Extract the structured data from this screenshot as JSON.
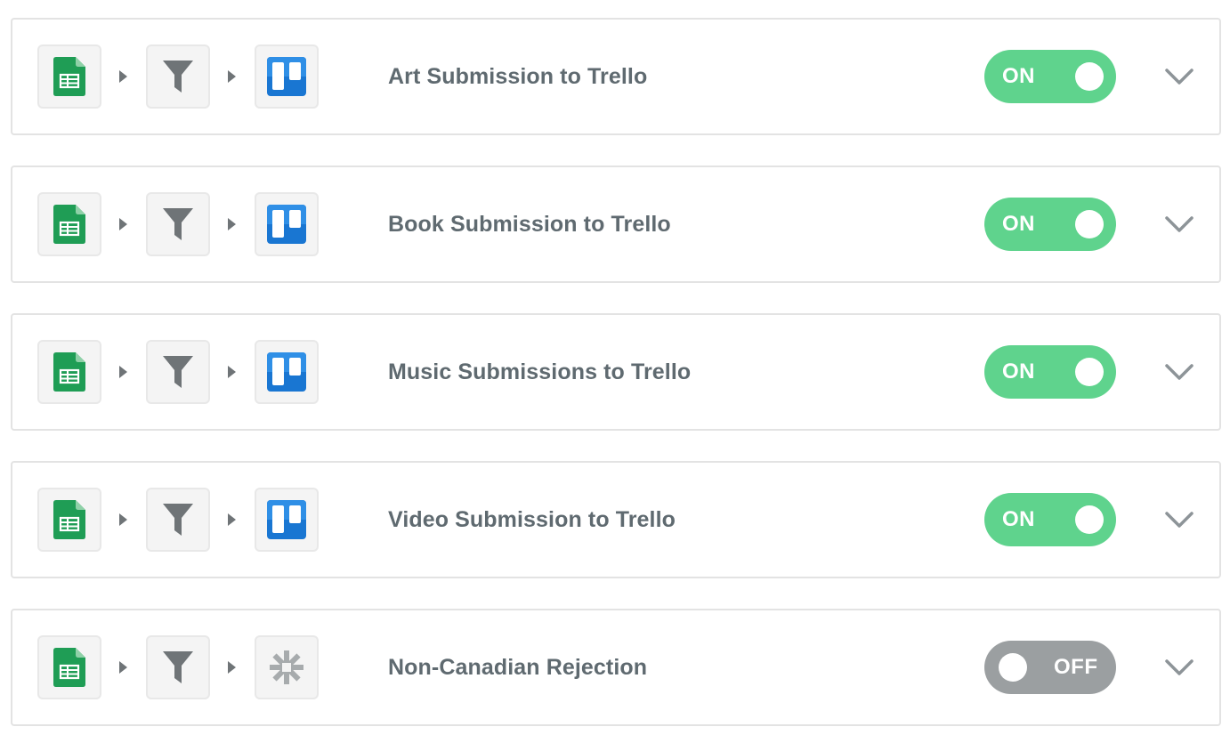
{
  "zaps": [
    {
      "title": "Art Submission to Trello",
      "trigger_icon": "google-sheets-icon",
      "filter_icon": "filter-icon",
      "action_icon": "trello-icon",
      "status": "on",
      "status_label": "ON"
    },
    {
      "title": "Book Submission to Trello",
      "trigger_icon": "google-sheets-icon",
      "filter_icon": "filter-icon",
      "action_icon": "trello-icon",
      "status": "on",
      "status_label": "ON"
    },
    {
      "title": "Music Submissions to Trello",
      "trigger_icon": "google-sheets-icon",
      "filter_icon": "filter-icon",
      "action_icon": "trello-icon",
      "status": "on",
      "status_label": "ON"
    },
    {
      "title": "Video Submission to Trello",
      "trigger_icon": "google-sheets-icon",
      "filter_icon": "filter-icon",
      "action_icon": "trello-icon",
      "status": "on",
      "status_label": "ON"
    },
    {
      "title": "Non-Canadian Rejection",
      "trigger_icon": "google-sheets-icon",
      "filter_icon": "filter-icon",
      "action_icon": "zapier-icon",
      "status": "off",
      "status_label": "OFF"
    }
  ],
  "colors": {
    "toggle_on": "#5fd38d",
    "toggle_off": "#9b9fa1",
    "title_text": "#5f6a70",
    "sheets_green": "#1f9d55",
    "trello_blue": "#1976d2",
    "filter_gray": "#6f7477"
  }
}
